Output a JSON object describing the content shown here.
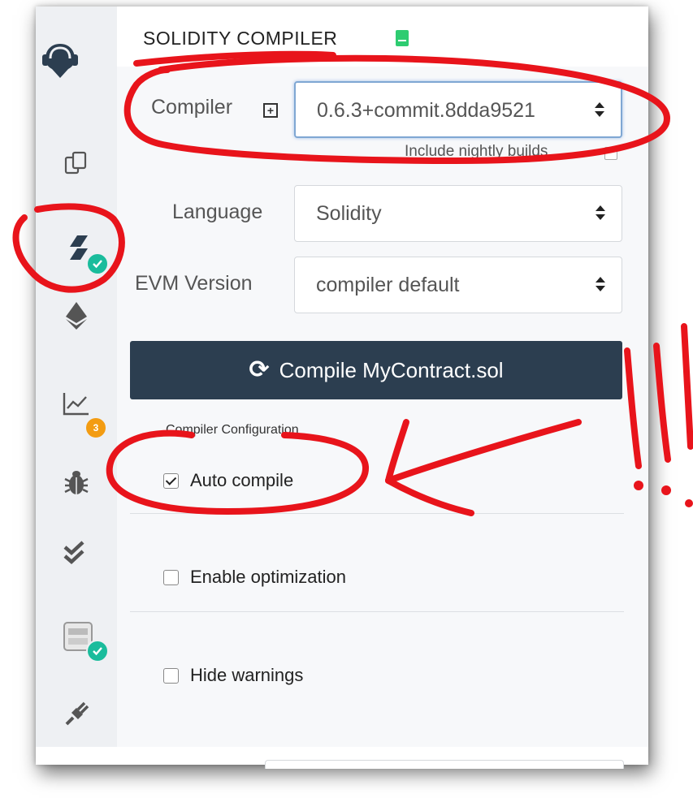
{
  "header": {
    "title": "SOLIDITY COMPILER"
  },
  "compiler": {
    "label": "Compiler",
    "value": "0.6.3+commit.8dda9521",
    "nightly_label": "Include nightly builds"
  },
  "language": {
    "label": "Language",
    "value": "Solidity"
  },
  "evm": {
    "label": "EVM Version",
    "value": "compiler default"
  },
  "compile_button": {
    "label": "Compile MyContract.sol"
  },
  "config": {
    "section_label": "Compiler Configuration",
    "auto_compile": {
      "label": "Auto compile",
      "checked": true
    },
    "optimization": {
      "label": "Enable optimization",
      "checked": false
    },
    "hide_warnings": {
      "label": "Hide warnings",
      "checked": false
    }
  },
  "sidebar": {
    "items": [
      {
        "icon": "remix-logo-icon"
      },
      {
        "icon": "file-explorer-icon"
      },
      {
        "icon": "solidity-compiler-icon",
        "status": "check"
      },
      {
        "icon": "deploy-run-icon"
      },
      {
        "icon": "analysis-icon",
        "badge": "3"
      },
      {
        "icon": "debugger-icon"
      },
      {
        "icon": "unit-testing-icon"
      },
      {
        "icon": "plugin-icon",
        "status": "check"
      },
      {
        "icon": "plugin-manager-icon"
      }
    ]
  },
  "colors": {
    "button_bg": "#2c3e50",
    "badge_orange": "#f39c12",
    "check_green": "#1abc9c",
    "annotation_red": "#e8141b",
    "sidebar_bg": "#eef0f3"
  }
}
